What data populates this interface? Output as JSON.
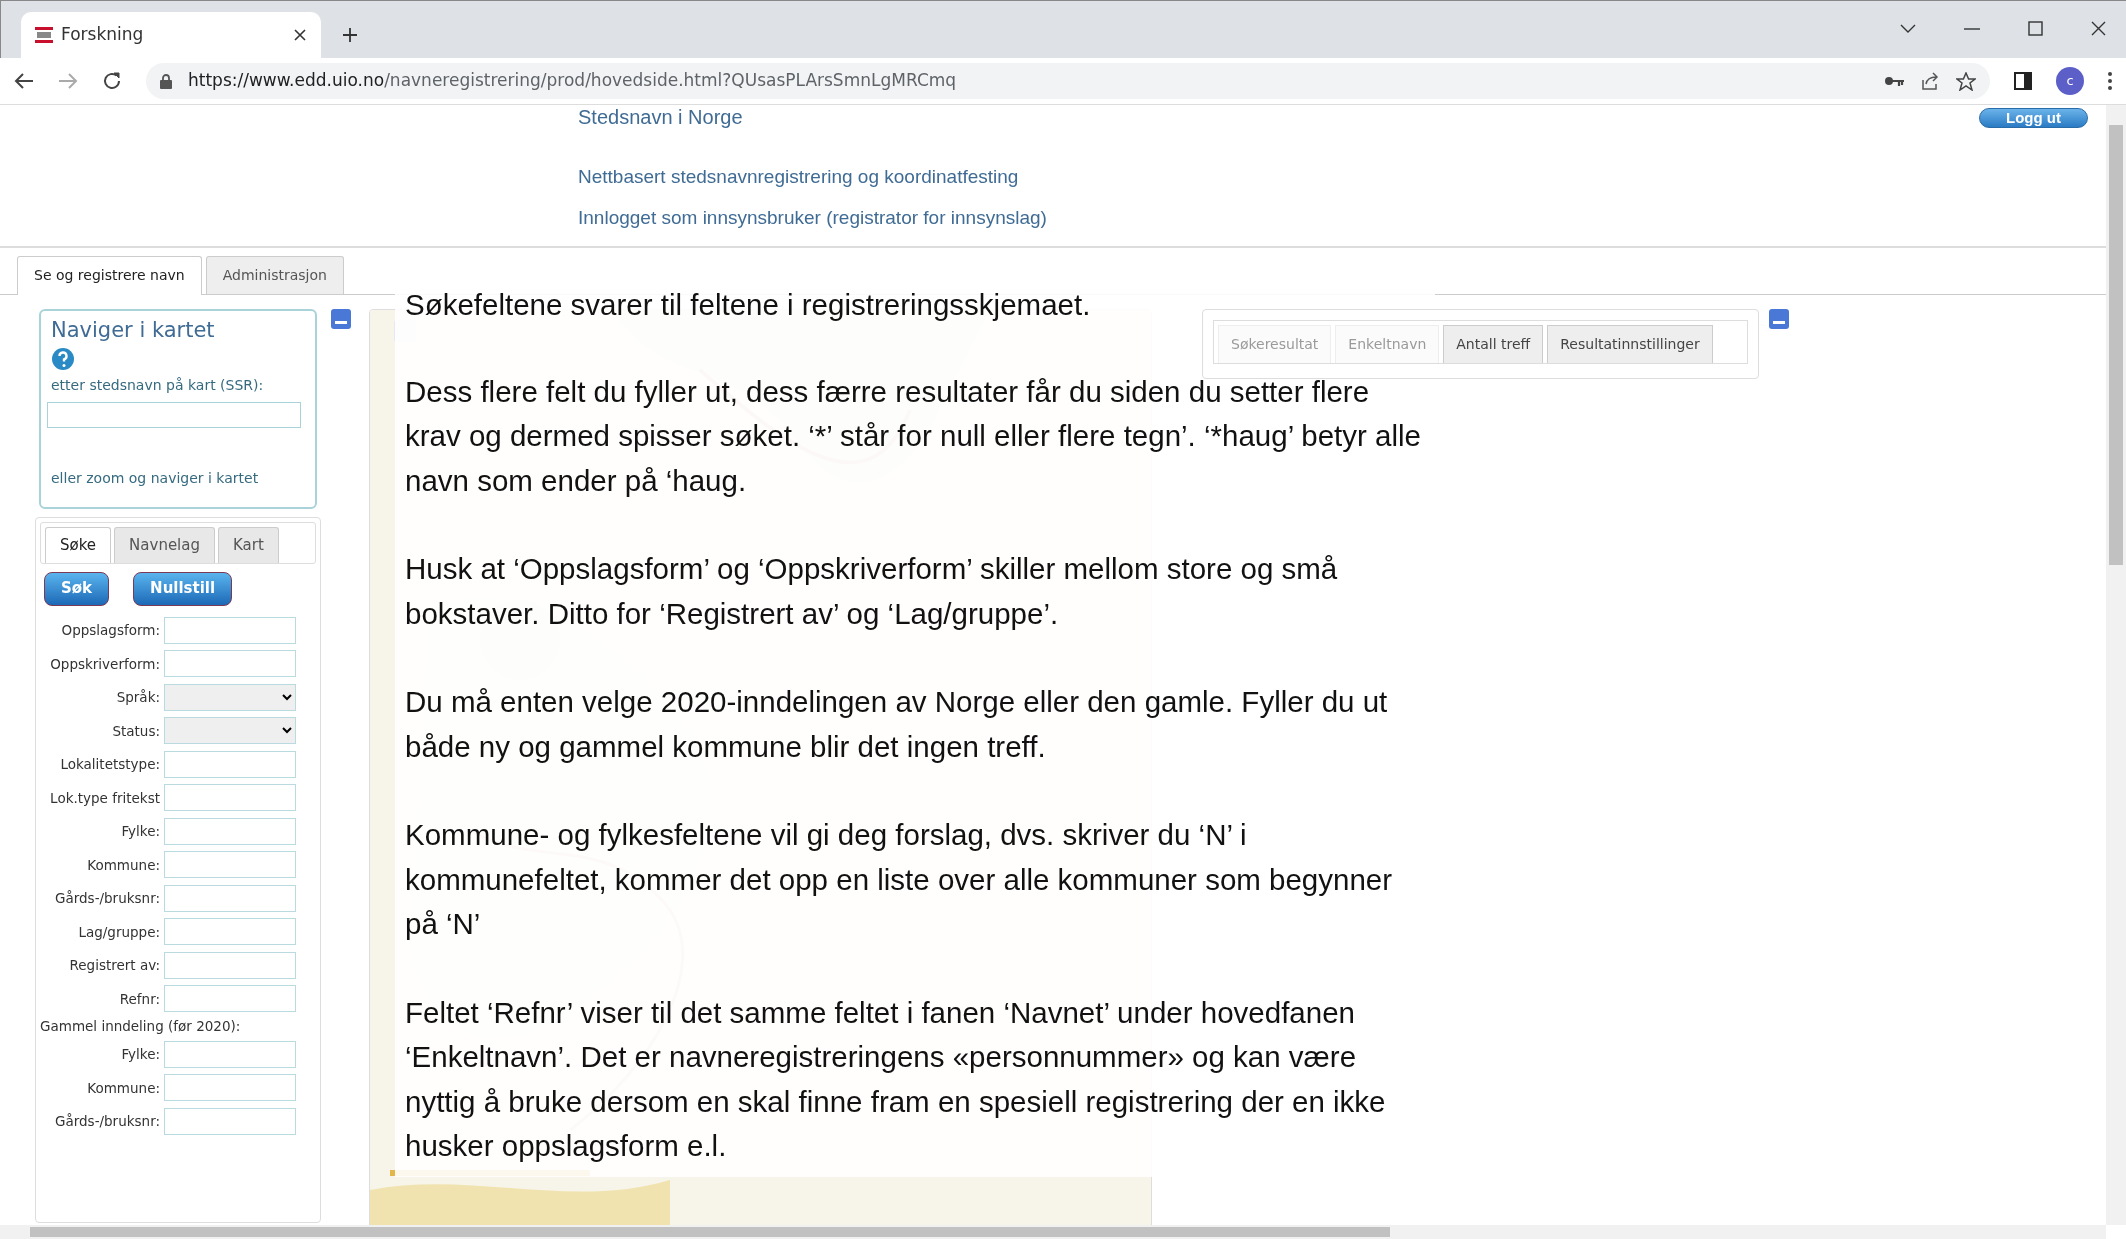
{
  "browser": {
    "tab_title": "Forskning",
    "url": {
      "host": "https://www.edd.uio.no",
      "path": "/navneregistrering/prod/hovedside.html?QUsasPLArsSmnLgMRCmq"
    },
    "avatar": "c"
  },
  "header": {
    "title": "Stedsnavn i Norge",
    "subtitle": "Nettbasert stedsnavnregistrering og koordinatfesting",
    "login_status": "Innlogget som innsynsbruker (registrator for innsynslag)",
    "logout_button": "Logg ut"
  },
  "main_tabs": [
    {
      "label": "Se og registrere navn",
      "selected": true
    },
    {
      "label": "Administrasjon",
      "selected": false
    }
  ],
  "navigate": {
    "title": "Naviger i kartet",
    "search_label": "etter stedsnavn på kart (SSR):",
    "hint": "eller zoom og naviger i kartet"
  },
  "sub_tabs": [
    {
      "label": "Søke",
      "selected": true
    },
    {
      "label": "Navnelag",
      "selected": false
    },
    {
      "label": "Kart",
      "selected": false
    }
  ],
  "buttons": [
    "Søk",
    "Nullstill"
  ],
  "fields": [
    {
      "kind": "text",
      "label": "Oppslagsform:"
    },
    {
      "kind": "text",
      "label": "Oppskriverform:"
    },
    {
      "kind": "select",
      "label": "Språk:"
    },
    {
      "kind": "select",
      "label": "Status:"
    },
    {
      "kind": "text",
      "label": "Lokalitetstype:"
    },
    {
      "kind": "text",
      "label": "Lok.type fritekst"
    },
    {
      "kind": "text",
      "label": "Fylke:"
    },
    {
      "kind": "text",
      "label": "Kommune:"
    },
    {
      "kind": "text",
      "label": "Gårds-/bruksnr:"
    },
    {
      "kind": "text",
      "label": "Lag/gruppe:"
    },
    {
      "kind": "text",
      "label": "Registrert av:"
    },
    {
      "kind": "text",
      "label": "Refnr:"
    },
    {
      "kind": "heading",
      "label": "Gammel inndeling (før 2020):"
    },
    {
      "kind": "text",
      "label": "Fylke:"
    },
    {
      "kind": "text",
      "label": "Kommune:"
    },
    {
      "kind": "text",
      "label": "Gårds-/bruksnr:"
    }
  ],
  "result_tabs": [
    {
      "label": "Søkeresultat",
      "disabled": true
    },
    {
      "label": "Enkeltnavn",
      "disabled": true
    },
    {
      "label": "Antall treff",
      "disabled": false
    },
    {
      "label": "Resultatinnstillinger",
      "disabled": false
    }
  ],
  "help_overlay": [
    "Søkefeltene svarer til  feltene  i registreringsskjemaet.",
    "Dess flere felt du fyller ut, dess færre resultater får du siden du setter flere krav og dermed spisser søket. ‘*’ står for null eller flere tegn’. ‘*haug’ betyr alle navn som ender på ‘haug.",
    "Husk at ‘Oppslagsform’ og ‘Oppskriverform’ skiller mellom store og små bokstaver. Ditto for ‘Registrert av’ og  ‘Lag/gruppe’.",
    "Du må enten velge 2020-inndelingen av Norge eller den gamle. Fyller du ut både ny og gammel kommune blir det ingen treff.",
    "Kommune- og fylkesfeltene vil gi deg forslag, dvs. skriver du ‘N’ i kommunefeltet, kommer det opp en liste over alle kommuner som begynner på ‘N’",
    "Feltet ‘Refnr’ viser til det samme feltet i fanen ‘Navnet’ under hovedfanen ‘Enkeltnavn’.  Det er navneregistreringens «personnummer» og kan være nyttig å bruke dersom en skal finne fram en spesiell registrering der en ikke husker oppslagsform e.l."
  ]
}
